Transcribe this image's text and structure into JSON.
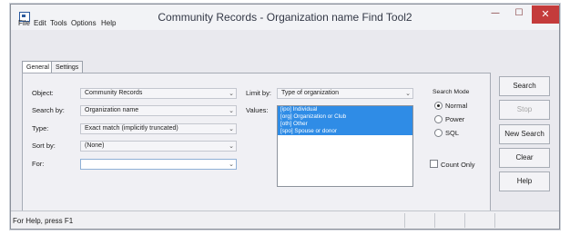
{
  "window": {
    "title": "Community Records - Organization name Find Tool2",
    "min_glyph": "—",
    "max_glyph": "☐",
    "close_glyph": "✕"
  },
  "menu": [
    "File",
    "Edit",
    "Tools",
    "Options",
    "Help"
  ],
  "tabs": [
    {
      "label": "General",
      "active": true
    },
    {
      "label": "Settings",
      "active": false
    }
  ],
  "form": {
    "object_label": "Object:",
    "object_value": "Community Records",
    "search_by_label": "Search by:",
    "search_by_value": "Organization name",
    "type_label": "Type:",
    "type_value": "Exact match (implicitly truncated)",
    "sort_by_label": "Sort by:",
    "sort_by_value": "(None)",
    "for_label": "For:",
    "for_value": "",
    "limit_by_label": "Limit by:",
    "limit_by_value": "Type of organization",
    "values_label": "Values:",
    "values": [
      "[ipo] Individual",
      "[org] Organization or Club",
      "[oth] Other",
      "[spo] Spouse or donor"
    ],
    "dropdown_arrow": "⌄"
  },
  "search_mode": {
    "label": "Search Mode",
    "options": [
      "Normal",
      "Power",
      "SQL"
    ],
    "selected": "Normal"
  },
  "count_only_label": "Count Only",
  "buttons": {
    "search": "Search",
    "stop": "Stop",
    "new_search": "New Search",
    "clear": "Clear",
    "help": "Help"
  },
  "status": {
    "text": "For Help, press F1"
  }
}
